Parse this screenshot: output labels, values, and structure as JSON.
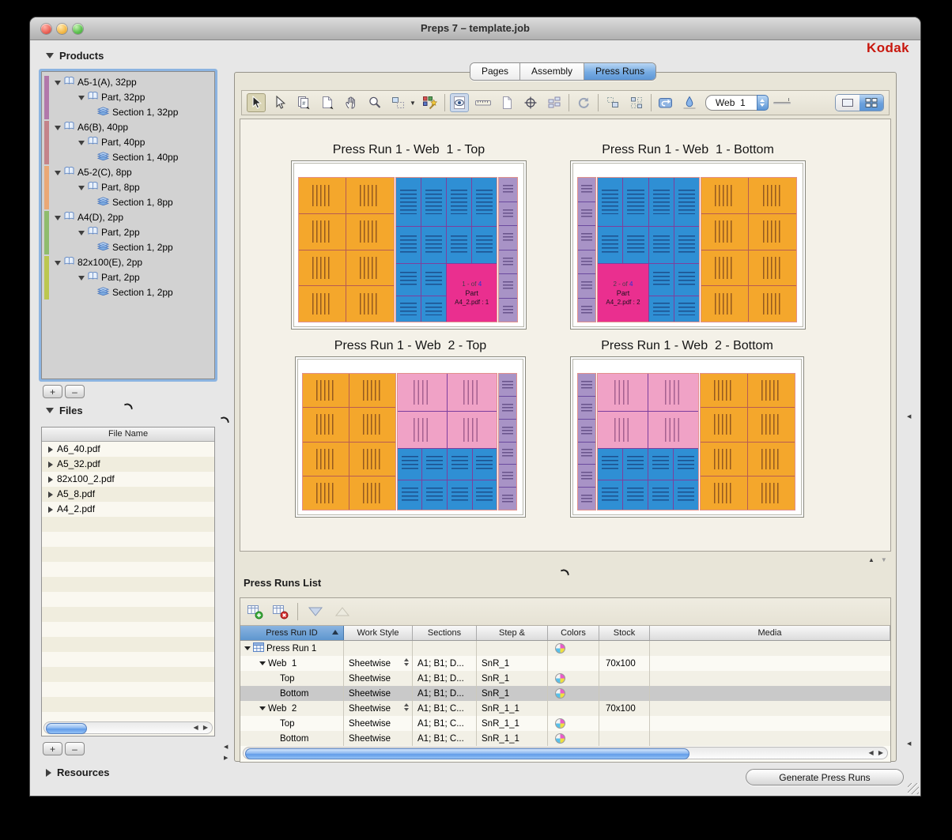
{
  "window": {
    "title": "Preps 7 – template.job",
    "brand": "Kodak"
  },
  "tabs": [
    {
      "label": "Pages",
      "active": false
    },
    {
      "label": "Assembly",
      "active": false
    },
    {
      "label": "Press Runs",
      "active": true
    }
  ],
  "sidebar": {
    "products": {
      "header": "Products",
      "add_label": "+",
      "remove_label": "–",
      "groups": [
        {
          "color": "#b178aa",
          "product": "A5-1(A), 32pp",
          "part": "Part, 32pp",
          "section": "Section 1, 32pp"
        },
        {
          "color": "#c4838a",
          "product": "A6(B), 40pp",
          "part": "Part, 40pp",
          "section": "Section 1, 40pp"
        },
        {
          "color": "#eaa876",
          "product": "A5-2(C), 8pp",
          "part": "Part, 8pp",
          "section": "Section 1, 8pp"
        },
        {
          "color": "#8fbc6d",
          "product": "A4(D), 2pp",
          "part": "Part, 2pp",
          "section": "Section 1, 2pp"
        },
        {
          "color": "#bcc74f",
          "product": "82x100(E), 2pp",
          "part": "Part, 2pp",
          "section": "Section 1, 2pp"
        }
      ]
    },
    "files": {
      "header": "Files",
      "column_header": "File Name",
      "add_label": "+",
      "remove_label": "–",
      "rows": [
        "A6_40.pdf",
        "A5_32.pdf",
        "82x100_2.pdf",
        "A5_8.pdf",
        "A4_2.pdf"
      ]
    },
    "resources": {
      "header": "Resources"
    }
  },
  "toolbar": {
    "web_selector_value": "Web  1",
    "icons": [
      "select-tool",
      "direct-select-tool",
      "numbered-pages-tool",
      "create-page-tool",
      "pan-tool",
      "zoom-tool",
      "marquee-zoom-tool",
      "imposition-wizard",
      "preview-mode-toggle",
      "measure-tool",
      "page-proof-tool",
      "center-point-tool",
      "split-view-tool",
      "refresh-tool",
      "move-group-tool",
      "align-group-tool",
      "go-back-tool",
      "ink-tool"
    ]
  },
  "previews": [
    {
      "title": "Press Run 1 - Web  1 - Top",
      "layout": "web1-top",
      "badge": {
        "page": "1 - of",
        "count": "4",
        "part": "Part",
        "file": "A4_2.pdf : 1"
      }
    },
    {
      "title": "Press Run 1 - Web  1 - Bottom",
      "layout": "web1-bottom",
      "badge": {
        "page": "2 - of",
        "count": "4",
        "part": "Part",
        "file": "A4_2.pdf : 2"
      }
    },
    {
      "title": "Press Run 1 - Web  2 - Top",
      "layout": "web2-top"
    },
    {
      "title": "Press Run 1 - Web  2 - Bottom",
      "layout": "web2-bottom"
    }
  ],
  "press_runs_list": {
    "title": "Press Runs List",
    "columns": [
      "Press Run ID",
      "Work Style",
      "Sections",
      "Step &",
      "Colors",
      "Stock",
      "Media"
    ],
    "rows": [
      {
        "indent": 0,
        "expander": true,
        "run_icon": true,
        "id": "Press Run 1",
        "work_style": "",
        "stepper": false,
        "sections": "",
        "step": "",
        "colors": true,
        "stock": "",
        "selected": false
      },
      {
        "indent": 1,
        "expander": true,
        "run_icon": false,
        "id": "Web  1",
        "work_style": "Sheetwise",
        "stepper": true,
        "sections": "A1; B1; D...",
        "step": "SnR_1",
        "colors": false,
        "stock": "70x100",
        "selected": false
      },
      {
        "indent": 2,
        "expander": false,
        "run_icon": false,
        "id": "Top",
        "work_style": "Sheetwise",
        "stepper": false,
        "sections": "A1; B1; D...",
        "step": "SnR_1",
        "colors": true,
        "stock": "",
        "selected": false
      },
      {
        "indent": 2,
        "expander": false,
        "run_icon": false,
        "id": "Bottom",
        "work_style": "Sheetwise",
        "stepper": false,
        "sections": "A1; B1; D...",
        "step": "SnR_1",
        "colors": true,
        "stock": "",
        "selected": true
      },
      {
        "indent": 1,
        "expander": true,
        "run_icon": false,
        "id": "Web  2",
        "work_style": "Sheetwise",
        "stepper": true,
        "sections": "A1; B1; C...",
        "step": "SnR_1_1",
        "colors": false,
        "stock": "70x100",
        "selected": false
      },
      {
        "indent": 2,
        "expander": false,
        "run_icon": false,
        "id": "Top",
        "work_style": "Sheetwise",
        "stepper": false,
        "sections": "A1; B1; C...",
        "step": "SnR_1_1",
        "colors": true,
        "stock": "",
        "selected": false
      },
      {
        "indent": 2,
        "expander": false,
        "run_icon": false,
        "id": "Bottom",
        "work_style": "Sheetwise",
        "stepper": false,
        "sections": "A1; B1; C...",
        "step": "SnR_1_1",
        "colors": true,
        "stock": "",
        "selected": false
      }
    ]
  },
  "footer": {
    "generate_button": "Generate Press Runs"
  },
  "colors": {
    "accent_blue": "#5d96d6",
    "kodak_red": "#c8170d",
    "orange_cell": "#f4a72c",
    "blue_cell": "#2f8fd4",
    "magenta_cell": "#ea2f8f",
    "pink_cell": "#f0a2c6",
    "purple_cell": "#a893c6"
  }
}
